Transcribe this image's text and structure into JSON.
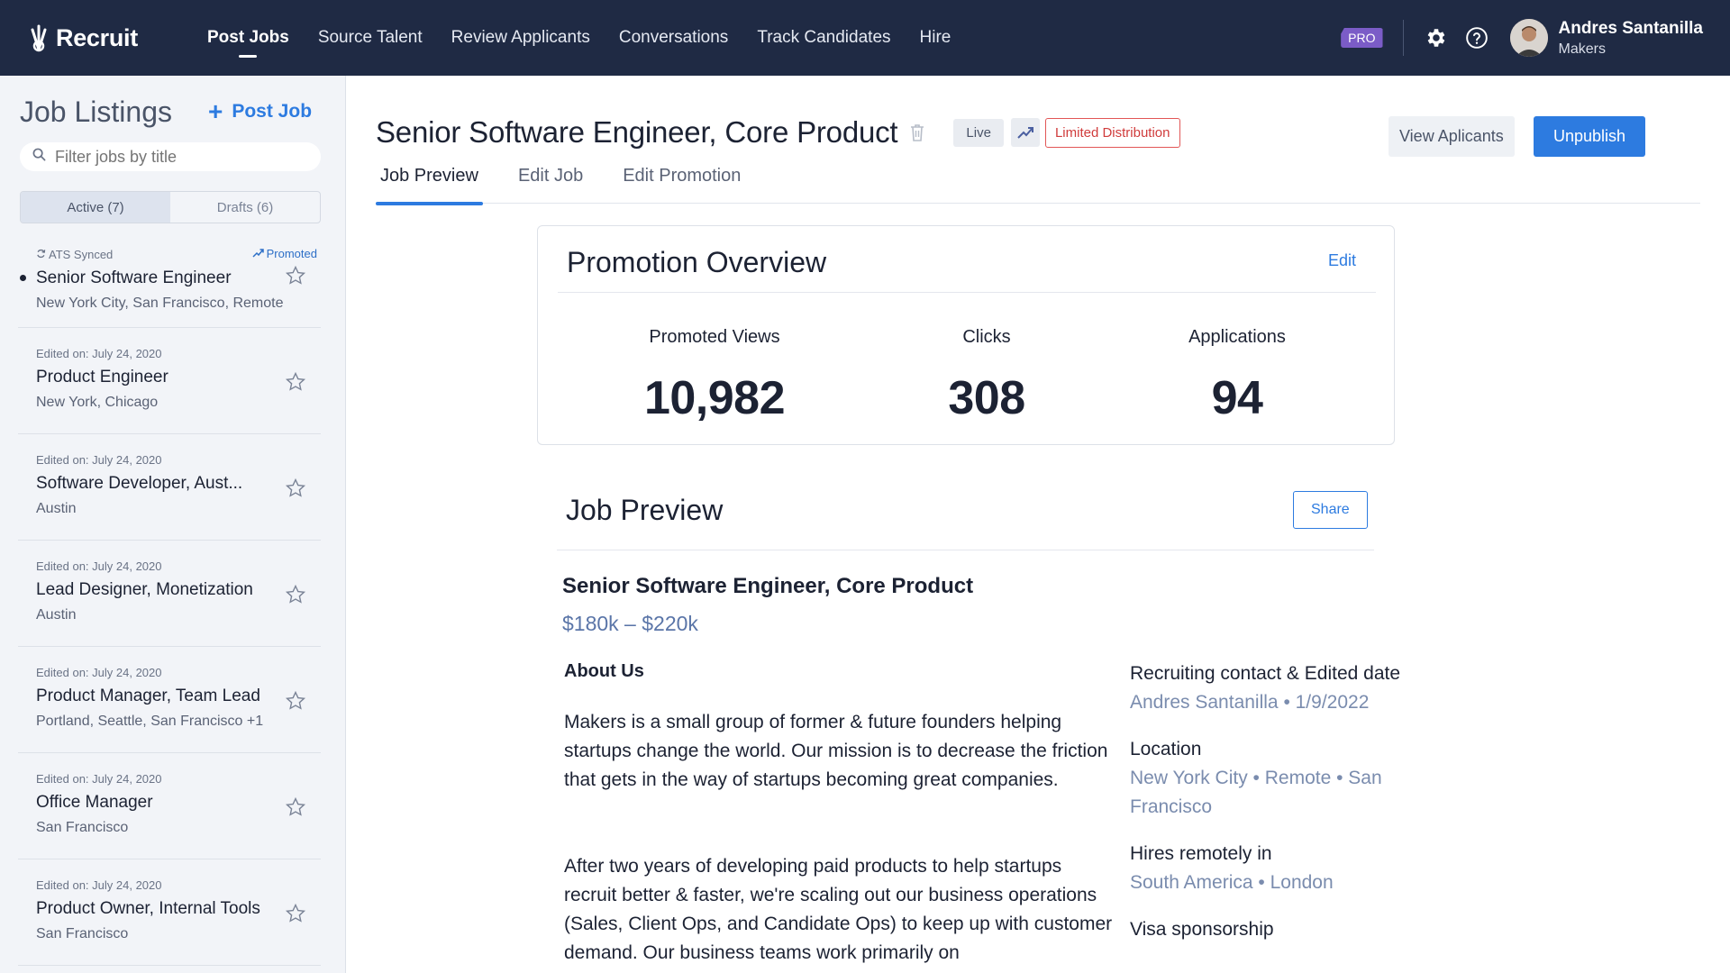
{
  "app": {
    "name": "Recruit"
  },
  "nav": {
    "items": [
      "Post Jobs",
      "Source Talent",
      "Review Applicants",
      "Conversations",
      "Track Candidates",
      "Hire"
    ],
    "active": "Post Jobs"
  },
  "topbar": {
    "pro_badge": "PRO",
    "user_name": "Andres Santanilla",
    "user_org": "Makers",
    "icons": [
      "gear-icon",
      "help-icon"
    ]
  },
  "sidebar": {
    "title": "Job Listings",
    "post_job_label": "Post Job",
    "search_placeholder": "Filter jobs by title",
    "tabs": [
      "Active (7)",
      "Drafts (6)"
    ],
    "jobs": [
      {
        "meta": "ATS Synced",
        "promoted": "Promoted",
        "title": "Senior Software Engineer",
        "location": "New York City, San Francisco, Remote"
      },
      {
        "meta": "Edited on: July 24, 2020",
        "title": "Product Engineer",
        "location": "New York, Chicago"
      },
      {
        "meta": "Edited on: July 24, 2020",
        "title": "Software Developer, Aust...",
        "location": "Austin"
      },
      {
        "meta": "Edited on: July 24, 2020",
        "title": "Lead Designer, Monetization",
        "location": "Austin"
      },
      {
        "meta": "Edited on: July 24, 2020",
        "title": "Product Manager, Team Lead",
        "location": "Portland, Seattle, San Francisco +1"
      },
      {
        "meta": "Edited on: July 24, 2020",
        "title": "Office Manager",
        "location": "San Francisco"
      },
      {
        "meta": "Edited on: July 24, 2020",
        "title": "Product Owner, Internal Tools",
        "location": "San Francisco"
      }
    ]
  },
  "header": {
    "title": "Senior Software Engineer, Core Product",
    "status_live": "Live",
    "status_limited": "Limited Distribution",
    "view_applicants": "View Aplicants",
    "unpublish": "Unpublish"
  },
  "tabs": [
    "Job Preview",
    "Edit Job",
    "Edit Promotion"
  ],
  "promotion": {
    "title": "Promotion Overview",
    "edit": "Edit",
    "stats": [
      {
        "label": "Promoted Views",
        "value": "10,982"
      },
      {
        "label": "Clicks",
        "value": "308"
      },
      {
        "label": "Applications",
        "value": "94"
      }
    ]
  },
  "preview": {
    "title": "Job Preview",
    "share": "Share",
    "job_title": "Senior Software Engineer, Core Product",
    "salary": "$180k – $220k",
    "about_title": "About Us",
    "about_p1": "Makers is a small group of former & future founders helping startups change the world. Our mission is to decrease the friction that gets in the way of startups becoming great companies.",
    "about_p2": "After two years of developing paid products to help startups recruit better & faster, we're scaling out our business operations (Sales, Client Ops, and Candidate Ops) to keep up with customer demand. Our business teams work primarily on",
    "side": [
      {
        "label": "Recruiting contact & Edited date",
        "value": "Andres Santanilla • 1/9/2022"
      },
      {
        "label": "Location",
        "value": "New York City • Remote • San Francisco"
      },
      {
        "label": "Hires remotely in",
        "value": "South America • London"
      },
      {
        "label": "Visa sponsorship",
        "value": ""
      }
    ]
  },
  "colors": {
    "nav_bg": "#1f2a44",
    "accent": "#2d7be0",
    "pro": "#7b5cc7",
    "danger": "#d03c3c"
  }
}
